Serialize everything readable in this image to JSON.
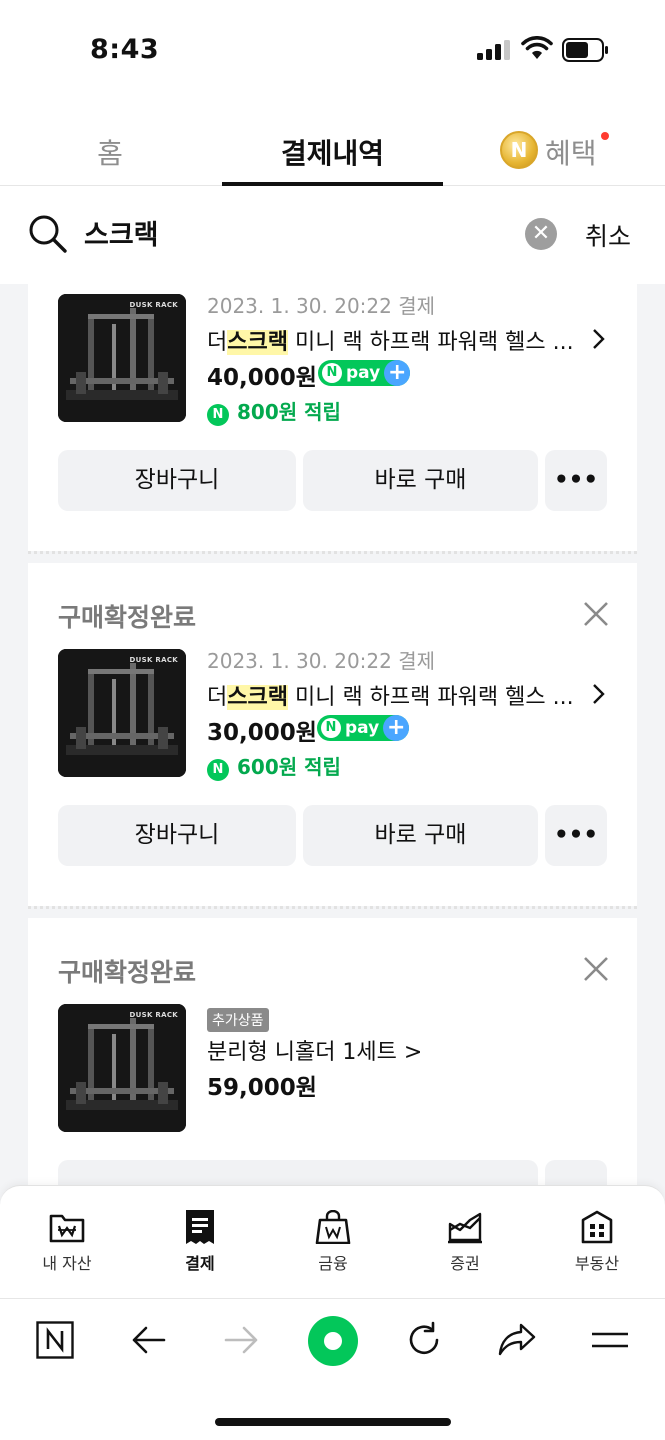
{
  "status_bar": {
    "time": "8:43"
  },
  "tabs": [
    {
      "label": "홈"
    },
    {
      "label": "결제내역"
    },
    {
      "label": "혜택"
    }
  ],
  "search": {
    "query": "스크랙",
    "cancel_label": "취소"
  },
  "orders": [
    {
      "status": "",
      "date": "2023. 1. 30. 20:22 결제",
      "title_prefix": "더",
      "title_highlight": "스크랙",
      "title_rest": " 미니 랙 하프랙 파워랙 헬스 ...",
      "price": "40,000원",
      "npay_label": "pay",
      "reward": "800원 적립",
      "thumb_brand": "DUSK RACK",
      "buttons": {
        "cart": "장바구니",
        "buy": "바로 구매",
        "more": "•••"
      }
    },
    {
      "status": "구매확정완료",
      "date": "2023. 1. 30. 20:22 결제",
      "title_prefix": "더",
      "title_highlight": "스크랙",
      "title_rest": " 미니 랙 하프랙 파워랙 헬스 ...",
      "price": "30,000원",
      "npay_label": "pay",
      "reward": "600원 적립",
      "thumb_brand": "DUSK RACK",
      "buttons": {
        "cart": "장바구니",
        "buy": "바로 구매",
        "more": "•••"
      }
    },
    {
      "status": "구매확정완료",
      "badge": "추가상품",
      "title": "분리형 니홀더 1세트 >",
      "price": "59,000원",
      "thumb_brand": "DUSK RACK"
    }
  ],
  "bottom_nav": [
    {
      "label": "내 자산",
      "icon": "wallet-icon"
    },
    {
      "label": "결제",
      "icon": "receipt-icon"
    },
    {
      "label": "금융",
      "icon": "bag-icon"
    },
    {
      "label": "증권",
      "icon": "chart-icon"
    },
    {
      "label": "부동산",
      "icon": "building-icon"
    }
  ],
  "colors": {
    "naver_green": "#03c75a",
    "highlight": "#fff7a8",
    "plus_blue": "#4aa6ff"
  }
}
